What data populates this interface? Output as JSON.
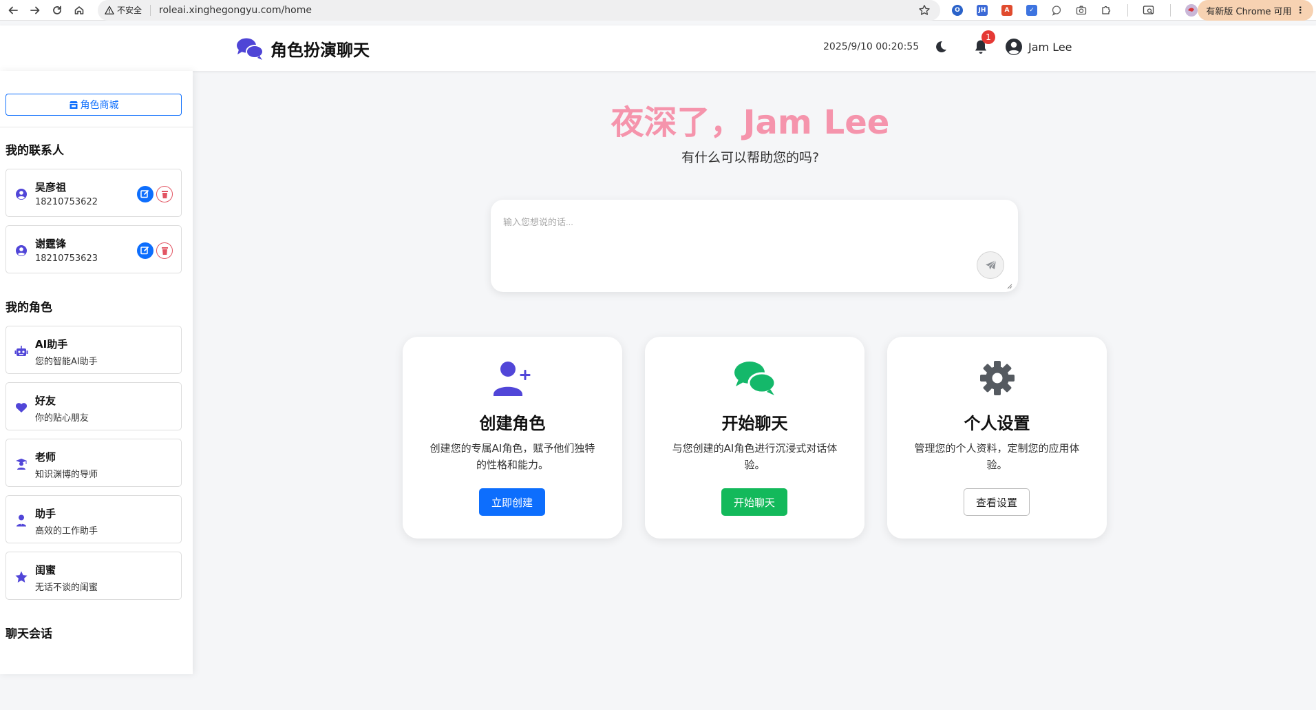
{
  "browser": {
    "security_label": "不安全",
    "url": "roleai.xinghegongyu.com/home",
    "update_label": "有新版 Chrome 可用",
    "extensions": [
      {
        "name": "ext-blue-circle",
        "color": "#2a62c9",
        "text": "O"
      },
      {
        "name": "ext-jh",
        "color": "#3b69d6",
        "text": "JH"
      },
      {
        "name": "ext-red-a",
        "color": "#e04b2e",
        "text": "A"
      },
      {
        "name": "ext-check",
        "color": "#3d74e0",
        "text": "✓"
      }
    ]
  },
  "header": {
    "title": "角色扮演聊天",
    "datetime": "2025/9/10 00:20:55",
    "notification_count": "1",
    "user_name": "Jam Lee"
  },
  "sidebar": {
    "store_label": "角色商城",
    "contacts_heading": "我的联系人",
    "contacts": [
      {
        "name": "吴彦祖",
        "phone": "18210753622"
      },
      {
        "name": "谢霆锋",
        "phone": "18210753623"
      }
    ],
    "roles_heading": "我的角色",
    "roles": [
      {
        "name": "AI助手",
        "desc": "您的智能AI助手",
        "icon": "robot-icon"
      },
      {
        "name": "好友",
        "desc": "你的贴心朋友",
        "icon": "heart-icon"
      },
      {
        "name": "老师",
        "desc": "知识渊博的导师",
        "icon": "teacher-icon"
      },
      {
        "name": "助手",
        "desc": "高效的工作助手",
        "icon": "user-tie-icon"
      },
      {
        "name": "闺蜜",
        "desc": "无话不谈的闺蜜",
        "icon": "star-icon"
      }
    ],
    "sessions_heading": "聊天会话"
  },
  "main": {
    "greeting": "夜深了，Jam Lee",
    "subtitle": "有什么可以帮助您的吗?",
    "input_placeholder": "输入您想说的话...",
    "cards": [
      {
        "title": "创建角色",
        "desc": "创建您的专属AI角色，赋予他们独特的性格和能力。",
        "button": "立即创建",
        "icon": "user-plus-icon"
      },
      {
        "title": "开始聊天",
        "desc": "与您创建的AI角色进行沉浸式对话体验。",
        "button": "开始聊天",
        "icon": "chat-bubbles-icon"
      },
      {
        "title": "个人设置",
        "desc": "管理您的个人资料，定制您的应用体验。",
        "button": "查看设置",
        "icon": "gear-icon"
      }
    ]
  },
  "colors": {
    "accent": "#0d6efd",
    "brand_purple": "#5146d8",
    "greeting_pink": "#f594ac",
    "success": "#13b95b",
    "danger": "#e25563",
    "icon_green": "#14b86a",
    "icon_gray": "#555a60"
  }
}
